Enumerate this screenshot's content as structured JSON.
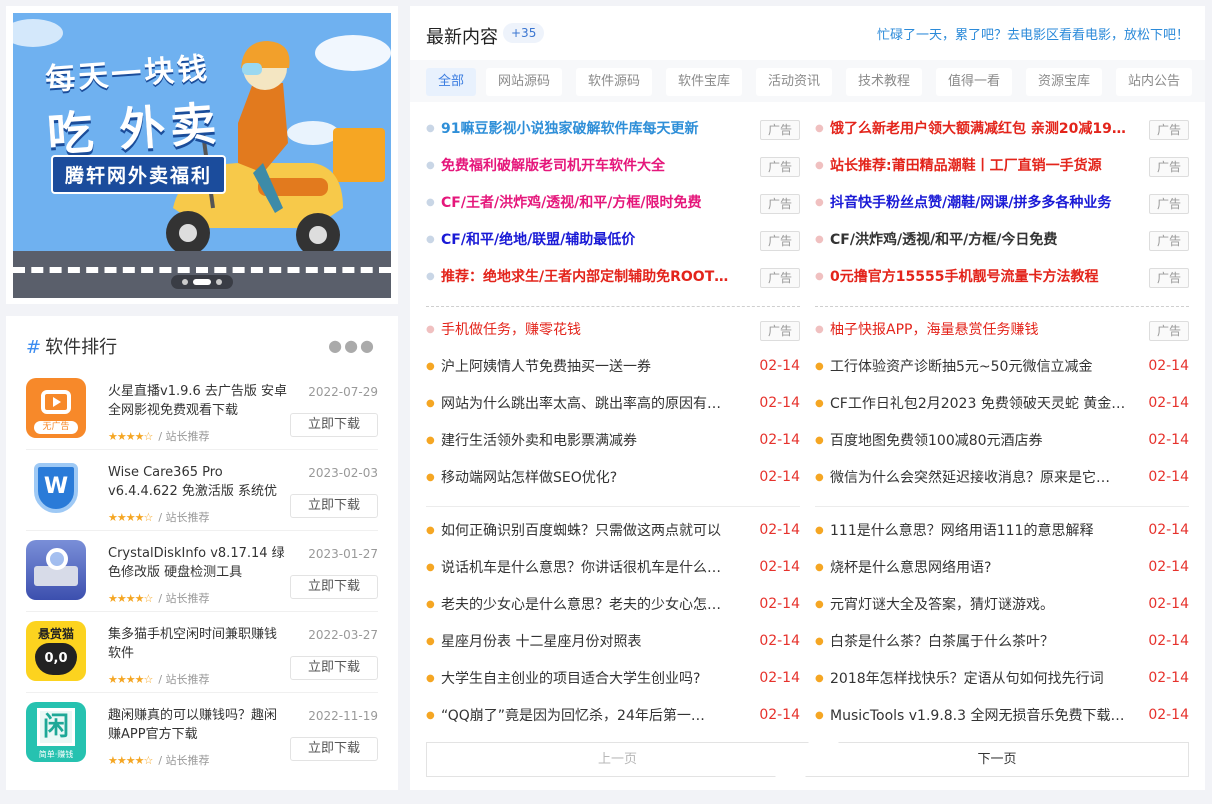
{
  "banner": {
    "line1": "每天一块钱",
    "line2": "吃 外卖",
    "line3": "腾轩网外卖福利"
  },
  "ranking": {
    "title": "软件排行",
    "items": [
      {
        "name": "火星直播v1.9.6 去广告版 安卓全网影视免费观看下载",
        "date": "2022-07-29",
        "stars": "★★★★☆",
        "by": "/ 站长推荐",
        "button": "立即下载",
        "icon_label": "无广告",
        "icon": "tv-play-icon"
      },
      {
        "name": "Wise Care365 Pro v6.4.4.622 免激活版 系统优化",
        "date": "2023-02-03",
        "stars": "★★★★☆",
        "by": "/ 站长推荐",
        "button": "立即下载",
        "icon_label": "W",
        "icon": "shield-icon"
      },
      {
        "name": "CrystalDiskInfo v8.17.14 绿色修改版 硬盘检测工具",
        "date": "2023-01-27",
        "stars": "★★★★☆",
        "by": "/ 站长推荐",
        "button": "立即下载",
        "icon_label": "",
        "icon": "disk-magnifier-icon"
      },
      {
        "name": "集多猫手机空闲时间兼职赚钱软件",
        "date": "2022-03-27",
        "stars": "★★★★☆",
        "by": "/ 站长推荐",
        "button": "立即下载",
        "icon_label": "悬赏猫",
        "icon_label2": "0,0",
        "icon": "cat-icon"
      },
      {
        "name": "趣闲赚真的可以赚钱吗？趣闲赚APP官方下载",
        "date": "2022-11-19",
        "stars": "★★★★☆",
        "by": "/ 站长推荐",
        "button": "立即下载",
        "icon_label": "闲",
        "icon_label2": "简单·赚钱",
        "icon": "xian-icon"
      }
    ]
  },
  "main": {
    "title": "最新内容",
    "count": "+35",
    "tip": "忙碌了一天，累了吧？去电影区看看电影，放松下吧！",
    "tabs": [
      "全部",
      "网站源码",
      "软件源码",
      "软件宝库",
      "活动资讯",
      "技术教程",
      "值得一看",
      "资源宝库",
      "站内公告"
    ],
    "active_tab": "全部",
    "ad_label": "广告",
    "ads_left": [
      {
        "text": "91嘛豆影视小说独家破解软件库每天更新",
        "color": "#2f8fd8"
      },
      {
        "text": "免费福利破解版老司机开车软件大全",
        "color": "#e5177b"
      },
      {
        "text": "CF/王者/洪炸鸡/透视/和平/方框/限时免费",
        "color": "#e5177b"
      },
      {
        "text": "CF/和平/绝地/联盟/辅助最低价",
        "color": "#1a1ad6"
      },
      {
        "text": "推荐：绝地求生/王者内部定制辅助免ROOT…",
        "color": "#e3241b"
      }
    ],
    "ads_right": [
      {
        "text": "饿了么新老用户领大额满减红包 亲测20减19…",
        "color": "#e3241b"
      },
      {
        "text": "站长推荐:莆田精品潮鞋丨工厂直销一手货源",
        "color": "#e3241b"
      },
      {
        "text": "抖音快手粉丝点赞/潮鞋/网课/拼多多各种业务",
        "color": "#1a1ad6"
      },
      {
        "text": "CF/洪炸鸡/透视/和平/方框/今日免费",
        "color": "#333333"
      },
      {
        "text": "0元撸官方15555手机靓号流量卡方法教程",
        "color": "#e3241b"
      }
    ],
    "promo_left": {
      "text": "手机做任务，赚零花钱",
      "color": "#e3241b"
    },
    "promo_right": {
      "text": "柚子快报APP，海量悬赏任务赚钱",
      "color": "#e3241b"
    },
    "posts_left_a": [
      {
        "text": "沪上阿姨情人节免费抽买一送一券",
        "date": "02-14"
      },
      {
        "text": "网站为什么跳出率太高、跳出率高的原因有…",
        "date": "02-14"
      },
      {
        "text": "建行生活领外卖和电影票满减券",
        "date": "02-14"
      },
      {
        "text": "移动端网站怎样做SEO优化?",
        "date": "02-14"
      }
    ],
    "posts_right_a": [
      {
        "text": "工行体验资产诊断抽5元~50元微信立减金",
        "date": "02-14"
      },
      {
        "text": "CF工作日礼包2月2023 免费领破天灵蛇 黄金…",
        "date": "02-14"
      },
      {
        "text": "百度地图免费领100减80元酒店券",
        "date": "02-14"
      },
      {
        "text": "微信为什么会突然延迟接收消息？原来是它…",
        "date": "02-14"
      }
    ],
    "posts_left_b": [
      {
        "text": "如何正确识别百度蜘蛛？只需做这两点就可以",
        "date": "02-14"
      },
      {
        "text": "说话机车是什么意思？你讲话很机车是什么…",
        "date": "02-14"
      },
      {
        "text": "老夫的少女心是什么意思？老夫的少女心怎…",
        "date": "02-14"
      },
      {
        "text": "星座月份表 十二星座月份对照表",
        "date": "02-14"
      },
      {
        "text": "大学生自主创业的项目适合大学生创业吗?",
        "date": "02-14"
      },
      {
        "text": "“QQ崩了”竟是因为回忆杀，24年后第一…",
        "date": "02-14"
      }
    ],
    "posts_right_b": [
      {
        "text": "111是什么意思？网络用语111的意思解释",
        "date": "02-14"
      },
      {
        "text": "烧杯是什么意思网络用语?",
        "date": "02-14"
      },
      {
        "text": "元宵灯谜大全及答案，猜灯谜游戏。",
        "date": "02-14"
      },
      {
        "text": "白茶是什么茶？白茶属于什么茶叶？",
        "date": "02-14"
      },
      {
        "text": "2018年怎样找快乐？定语从句如何找先行词",
        "date": "02-14"
      },
      {
        "text": "MusicTools v1.9.8.3 全网无损音乐免费下载…",
        "date": "02-14"
      }
    ],
    "pager": {
      "prev": "上一页",
      "next": "下一页"
    }
  }
}
